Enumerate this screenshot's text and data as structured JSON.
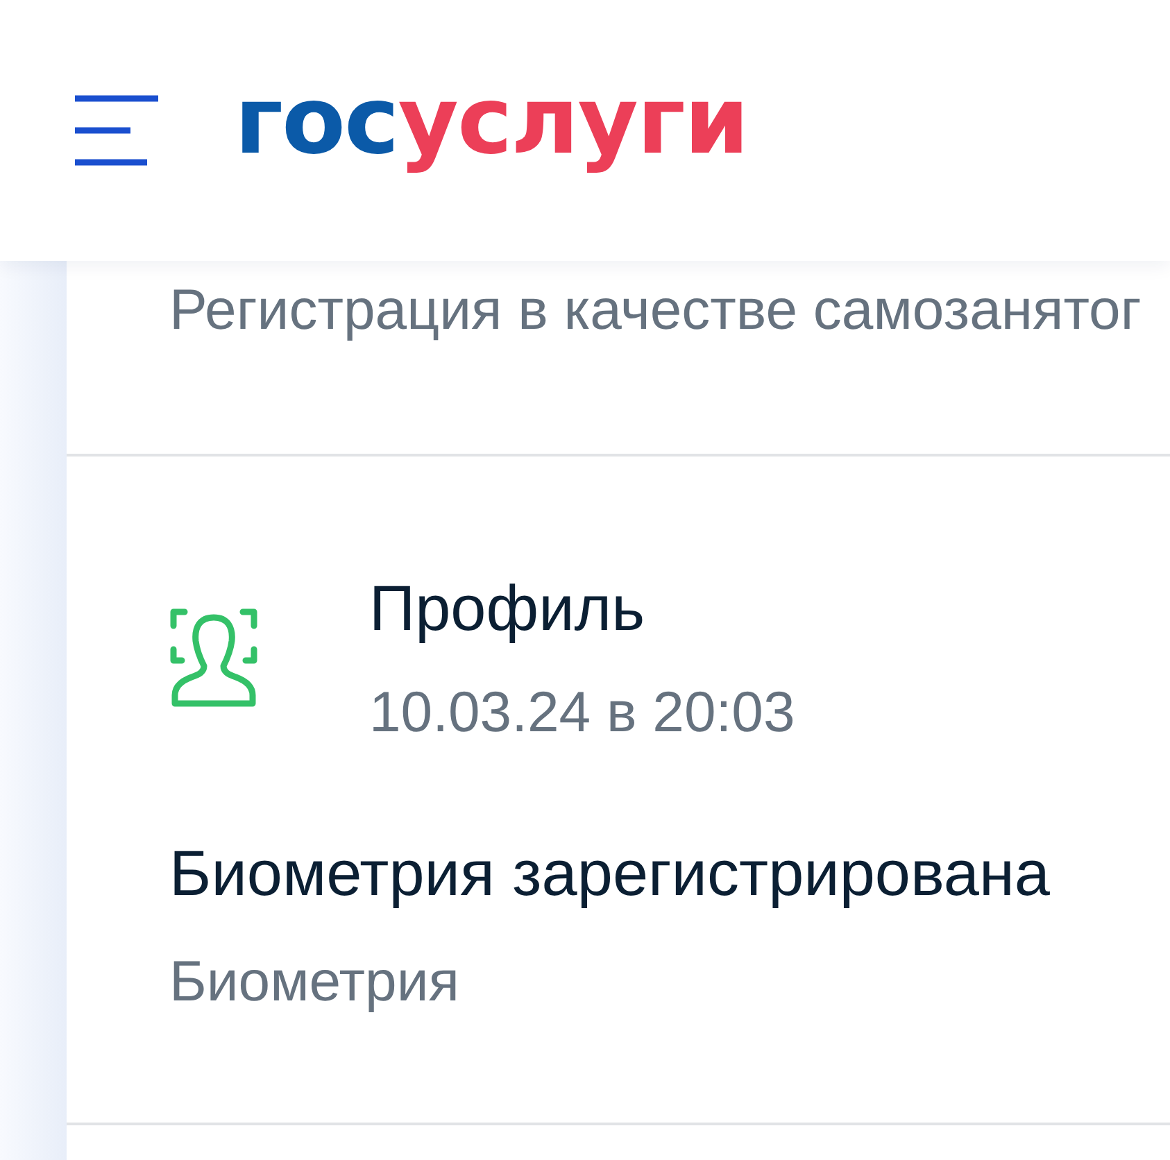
{
  "header": {
    "logo": {
      "part_1": "гос",
      "part_2": "услуги"
    }
  },
  "feed": {
    "items": [
      {
        "kind": "plain",
        "subtitle": "Регистрация в качестве самозанятог"
      },
      {
        "kind": "event",
        "source": "Профиль",
        "datetime": "10.03.24 в 20:03",
        "title": "Биометрия зарегистрирована",
        "subtitle": "Биометрия"
      }
    ]
  }
}
